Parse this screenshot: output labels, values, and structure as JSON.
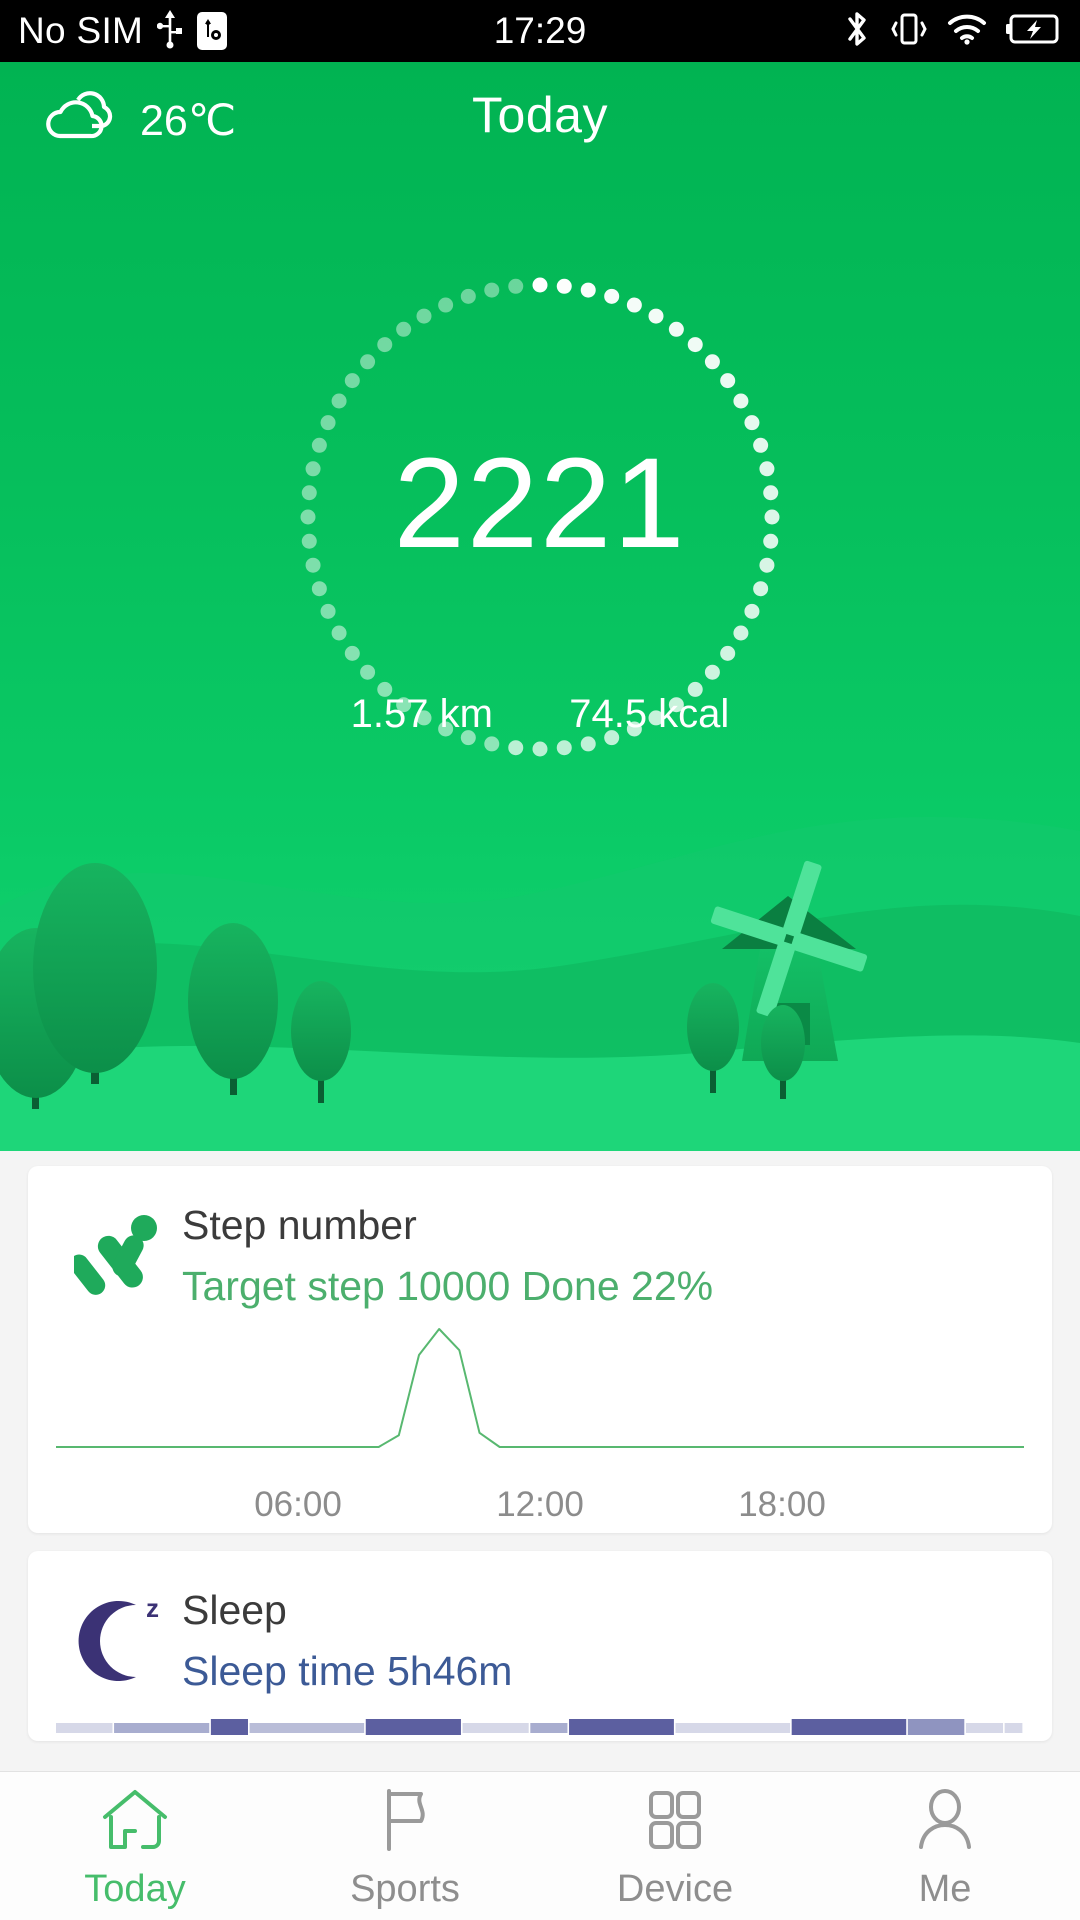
{
  "statusbar": {
    "carrier": "No SIM",
    "time": "17:29",
    "icons_left": [
      "usb-icon",
      "usb-debug-icon"
    ],
    "icons_right": [
      "bluetooth-icon",
      "vibrate-icon",
      "wifi-icon",
      "battery-charging-icon"
    ]
  },
  "hero": {
    "weather_icon": "cloud-icon",
    "temperature": "26℃",
    "title": "Today",
    "steps": "2221",
    "distance": "1.57 km",
    "calories": "74.5 kcal",
    "progress_percent": 22,
    "ring_dots_total": 60,
    "colors": {
      "green_top": "#01b352",
      "green_bottom": "#16d675",
      "dot_active": "#ffffff",
      "dot_inactive": "rgba(255,255,255,0.45)"
    },
    "scenery": [
      "trees",
      "hills",
      "windmill"
    ]
  },
  "cards": [
    {
      "icon": "running-person-icon",
      "title": "Step number",
      "subtitle": "Target step 10000 Done 22%",
      "subtitle_color": "#4caf6d",
      "accent": "#4caf6d",
      "chart_data": {
        "type": "line",
        "title": "Step number",
        "xlabel": "",
        "ylabel": "",
        "x": [
          0,
          1,
          2,
          3,
          4,
          5,
          6,
          7,
          8,
          8.5,
          9,
          9.5,
          10,
          10.5,
          11,
          12,
          13,
          14,
          15,
          16,
          17,
          18,
          19,
          20,
          21,
          22,
          23,
          24
        ],
        "values": [
          0,
          0,
          0,
          0,
          0,
          0,
          0,
          0,
          0,
          10,
          78,
          100,
          82,
          12,
          0,
          0,
          0,
          0,
          0,
          0,
          0,
          0,
          0,
          0,
          0,
          0,
          0,
          0
        ],
        "tick_labels": [
          "06:00",
          "12:00",
          "18:00"
        ],
        "tick_positions": [
          0.25,
          0.5,
          0.75
        ],
        "xlim": [
          0,
          24
        ],
        "ylim": [
          0,
          100
        ],
        "grid": false,
        "legend": "none",
        "line_color": "#58b870"
      }
    },
    {
      "icon": "moon-sleep-icon",
      "title": "Sleep",
      "subtitle": "Sleep time 5h46m",
      "subtitle_color": "#3c5a96",
      "accent": "#3b3275",
      "chart_data": {
        "type": "bar",
        "title": "Sleep",
        "xlabel": "",
        "ylabel": "",
        "categories": [
          "seg1",
          "seg2",
          "seg3",
          "seg4",
          "seg5",
          "seg6",
          "seg7",
          "seg8",
          "seg9",
          "seg10",
          "seg11",
          "seg12",
          "seg13"
        ],
        "values": [
          1,
          1,
          1,
          1,
          1,
          1,
          1,
          1,
          1,
          1,
          1,
          1,
          1
        ],
        "segment_colors": [
          "#d6d8e8",
          "#a8adcf",
          "#5c5fa0",
          "#b9bdd8",
          "#5c5fa0",
          "#d6d8e8",
          "#a8adcf",
          "#5c5fa0",
          "#d6d8e8",
          "#5c5fa0",
          "#8f94c0",
          "#d6d8e8",
          "#d6d8e8"
        ],
        "segment_widths": [
          6,
          10,
          4,
          12,
          10,
          7,
          4,
          11,
          12,
          12,
          6,
          4,
          2
        ],
        "grid": false,
        "legend": "none"
      }
    }
  ],
  "bottomnav": {
    "items": [
      {
        "label": "Today",
        "icon": "home-icon",
        "active": true
      },
      {
        "label": "Sports",
        "icon": "flag-icon",
        "active": false
      },
      {
        "label": "Device",
        "icon": "grid-icon",
        "active": false
      },
      {
        "label": "Me",
        "icon": "person-icon",
        "active": false
      }
    ],
    "active_color": "#46bd6b",
    "inactive_color": "#8e8e8e"
  }
}
